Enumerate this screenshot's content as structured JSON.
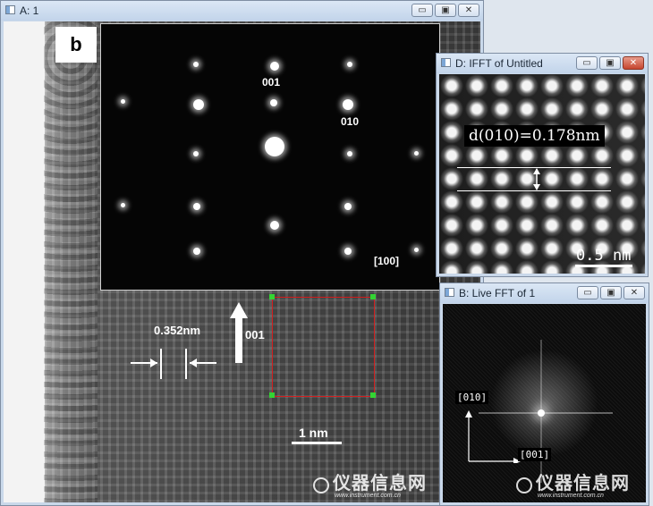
{
  "windows": {
    "main": {
      "title": "A: 1"
    },
    "ifft": {
      "title": "D: IFFT of Untitled"
    },
    "fft": {
      "title": "B: Live FFT of 1"
    }
  },
  "window_buttons": {
    "minimize": "▭",
    "maximize": "▣",
    "close": "✕"
  },
  "micrograph": {
    "panel_label": "b",
    "diffraction_labels": {
      "spot_001": "001",
      "spot_010": "010",
      "zone_axis": "[100]"
    },
    "spacing_label": "0.352nm",
    "direction_label": "001",
    "scale_bar": "1 nm"
  },
  "ifft": {
    "d_spacing": "d(010)=0.178nm",
    "scale_bar": "0.5 nm"
  },
  "fft": {
    "axis_vertical": "[010]",
    "axis_horizontal": "[001]"
  },
  "watermark": {
    "text": "仪器信息网",
    "url": "www.instrument.com.cn"
  },
  "colors": {
    "roi_box": "#d21e1e",
    "roi_handles": "#33d433",
    "title_bar": "#c2d4ea"
  }
}
